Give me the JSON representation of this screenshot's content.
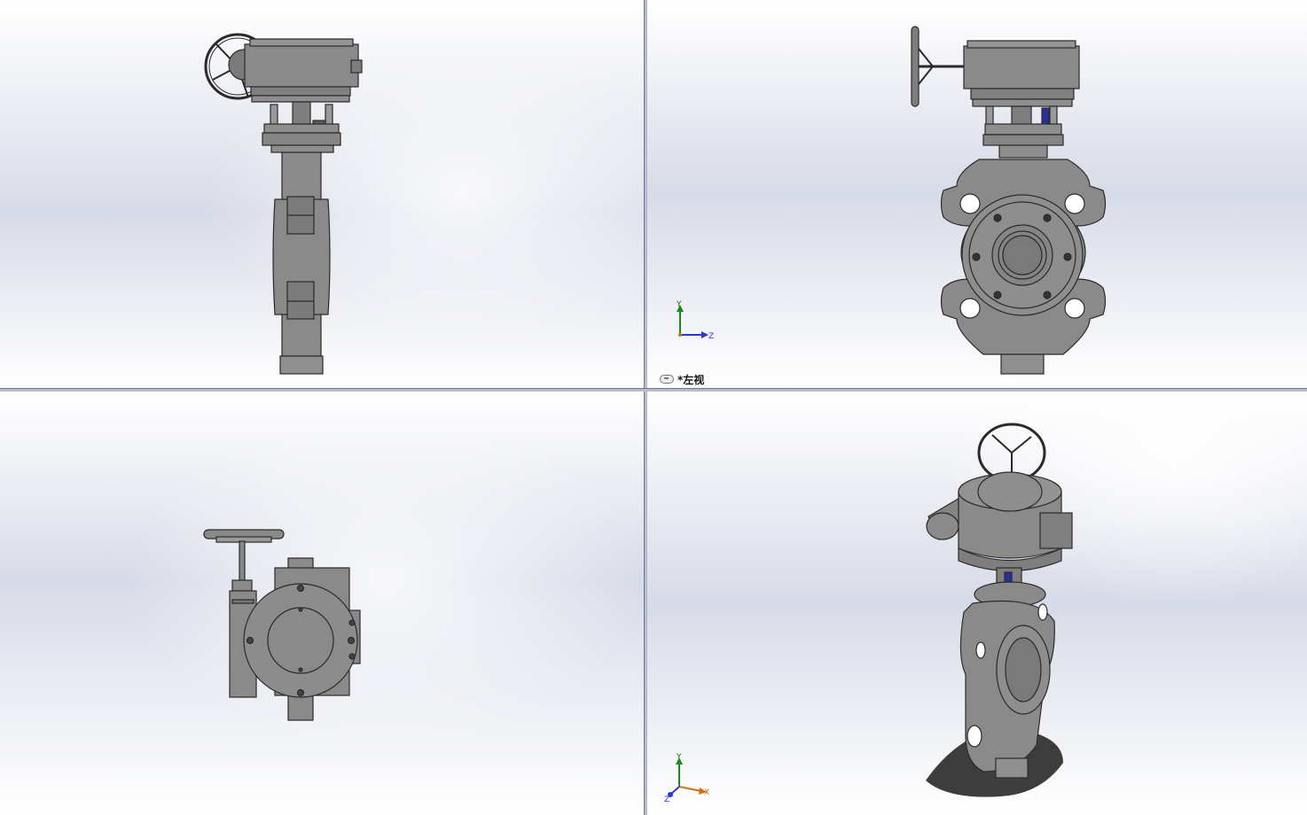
{
  "viewports": [
    {
      "id": "front",
      "name": "front-view"
    },
    {
      "id": "left",
      "name": "left-view",
      "label": "*左视"
    },
    {
      "id": "top",
      "name": "top-view"
    },
    {
      "id": "iso",
      "name": "isometric-view"
    }
  ],
  "triad_left": {
    "y": "Y",
    "z": "Z"
  },
  "triad_iso": {
    "y": "Y",
    "x": "X",
    "z": "Z"
  },
  "colors": {
    "background_top": "#ffffff",
    "background_mid": "#d9dde8",
    "part": "#8c8c8c",
    "part_dark": "#6e6e6e",
    "edge": "#2a2a2a",
    "stem_accent": "#2b2f9a",
    "axis_y": "#1a8a1a",
    "axis_z": "#2a3ad0",
    "axis_x": "#d07010",
    "separator": "#6c7390"
  },
  "icons": [
    "link-icon"
  ]
}
